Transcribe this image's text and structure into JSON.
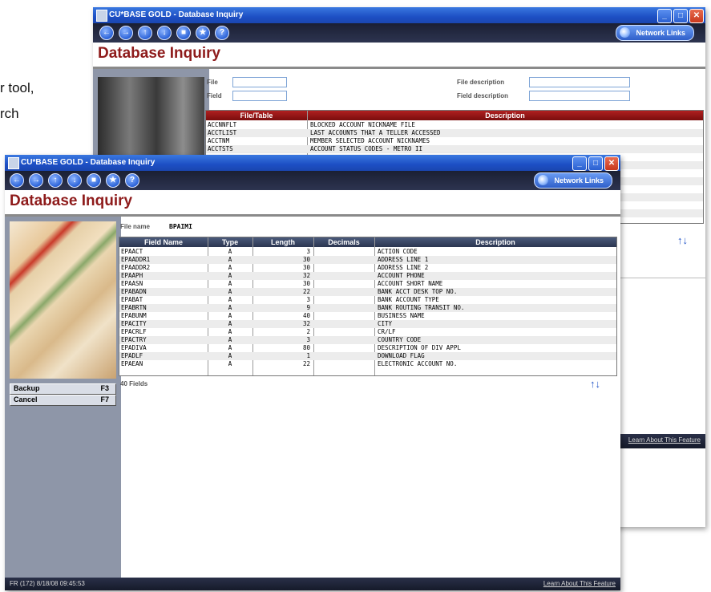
{
  "background_text": [
    "r tool,",
    "rch"
  ],
  "back_window": {
    "title": "CU*BASE GOLD - Database Inquiry",
    "network_links": "Network Links",
    "page_title": "Database Inquiry",
    "filters": {
      "file_label": "File",
      "field_label": "Field",
      "file_description_label": "File description",
      "field_description_label": "Field description"
    },
    "grid": {
      "columns": [
        "File/Table",
        "Description"
      ],
      "rows": [
        {
          "file": "ACCNNFLT",
          "desc": "BLOCKED ACCOUNT NICKNAME FILE"
        },
        {
          "file": "ACCTLIST",
          "desc": "LAST ACCOUNTS THAT A TELLER ACCESSED"
        },
        {
          "file": "ACCTNM",
          "desc": "MEMBER SELECTED ACCOUNT NICKNAMES"
        },
        {
          "file": "ACCTSTS",
          "desc": "ACCOUNT STATUS CODES - METRO II"
        }
      ]
    },
    "status_right": "Learn About This Feature"
  },
  "front_window": {
    "title": "CU*BASE GOLD - Database Inquiry",
    "network_links": "Network Links",
    "page_title": "Database Inquiry",
    "file_name_label": "File name",
    "file_name_value": "BPAIMI",
    "grid": {
      "columns": [
        "Field Name",
        "Type",
        "Length",
        "Decimals",
        "Description"
      ],
      "rows": [
        {
          "field": "EPAACT",
          "type": "A",
          "length": "3",
          "decimals": "",
          "desc": "ACTION CODE"
        },
        {
          "field": "EPAADDR1",
          "type": "A",
          "length": "30",
          "decimals": "",
          "desc": "ADDRESS LINE 1"
        },
        {
          "field": "EPAADDR2",
          "type": "A",
          "length": "30",
          "decimals": "",
          "desc": "ADDRESS LINE 2"
        },
        {
          "field": "EPAAPH",
          "type": "A",
          "length": "32",
          "decimals": "",
          "desc": "ACCOUNT PHONE"
        },
        {
          "field": "EPAASN",
          "type": "A",
          "length": "30",
          "decimals": "",
          "desc": "ACCOUNT SHORT NAME"
        },
        {
          "field": "EPABADN",
          "type": "A",
          "length": "22",
          "decimals": "",
          "desc": "BANK ACCT DESK TOP NO."
        },
        {
          "field": "EPABAT",
          "type": "A",
          "length": "3",
          "decimals": "",
          "desc": "BANK ACCOUNT TYPE"
        },
        {
          "field": "EPABRTN",
          "type": "A",
          "length": "9",
          "decimals": "",
          "desc": "BANK ROUTING TRANSIT NO."
        },
        {
          "field": "EPABUNM",
          "type": "A",
          "length": "40",
          "decimals": "",
          "desc": "BUSINESS NAME"
        },
        {
          "field": "EPACITY",
          "type": "A",
          "length": "32",
          "decimals": "",
          "desc": "CITY"
        },
        {
          "field": "EPACRLF",
          "type": "A",
          "length": "2",
          "decimals": "",
          "desc": "CR/LF"
        },
        {
          "field": "EPACTRY",
          "type": "A",
          "length": "3",
          "decimals": "",
          "desc": "COUNTRY CODE"
        },
        {
          "field": "EPADIVA",
          "type": "A",
          "length": "80",
          "decimals": "",
          "desc": "DESCRIPTION OF DIV APPL"
        },
        {
          "field": "EPADLF",
          "type": "A",
          "length": "1",
          "decimals": "",
          "desc": "DOWNLOAD FLAG"
        },
        {
          "field": "EPAEAN",
          "type": "A",
          "length": "22",
          "decimals": "",
          "desc": "ELECTRONIC ACCOUNT NO."
        }
      ]
    },
    "field_count": "40 Fields",
    "fkeys": [
      {
        "label": "Backup",
        "key": "F3"
      },
      {
        "label": "Cancel",
        "key": "F7"
      }
    ],
    "status_left": "FR (172) 8/18/08 09:45:53",
    "status_right": "Learn About This Feature"
  },
  "colors": {
    "title_accent": "#8e1b1b",
    "titlebar_blue": "#1d4fc4",
    "panel_gray": "#8e96a8",
    "arrow_blue": "#2456c8"
  }
}
